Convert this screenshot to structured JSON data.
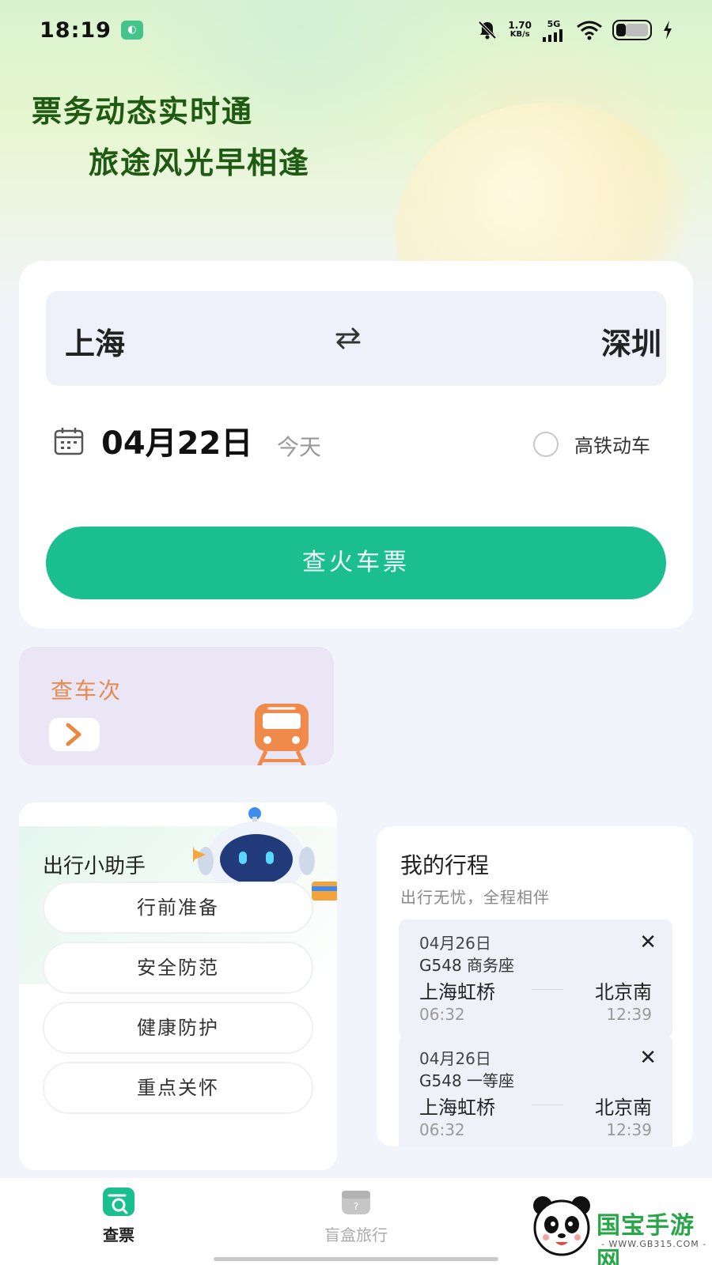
{
  "status_bar": {
    "time": "18:19",
    "app_badge_icon": "app-notification-icon",
    "net_speed_value": "1.70",
    "net_speed_unit": "KB/s",
    "network": "5G",
    "icons": [
      "mute-bell-icon",
      "signal-icon",
      "wifi-icon",
      "battery-icon",
      "charging-icon"
    ]
  },
  "hero": {
    "slogan_line1": "票务动态实时通",
    "slogan_line2": "旅途风光早相逢"
  },
  "search": {
    "from_city": "上海",
    "to_city": "深圳",
    "swap_icon": "swap-arrows-icon",
    "date": "04月22日",
    "date_sub": "今天",
    "high_speed_label": "高铁动车",
    "high_speed_checked": false,
    "search_button": "查火车票",
    "accent_color": "#1bbf8f"
  },
  "train_query": {
    "title": "查车次",
    "icon": "train-icon"
  },
  "assistant": {
    "title": "出行小助手",
    "items": [
      "行前准备",
      "安全防范",
      "健康防护",
      "重点关怀"
    ]
  },
  "trips": {
    "title": "我的行程",
    "subtitle": "出行无忧，全程相伴",
    "items": [
      {
        "date": "04月26日",
        "train": "G548 商务座",
        "from": "上海虹桥",
        "to": "北京南",
        "dep": "06:32",
        "arr": "12:39"
      },
      {
        "date": "04月26日",
        "train": "G548 一等座",
        "from": "上海虹桥",
        "to": "北京南",
        "dep": "06:32",
        "arr": "12:39"
      }
    ]
  },
  "tab_bar": {
    "tabs": [
      {
        "label": "查票",
        "icon": "ticket-search-icon",
        "active": true
      },
      {
        "label": "盲盒旅行",
        "icon": "gift-box-icon",
        "active": false
      }
    ]
  },
  "watermark": {
    "text": "国宝手游网",
    "url": "- WWW.GB315.COM -"
  }
}
